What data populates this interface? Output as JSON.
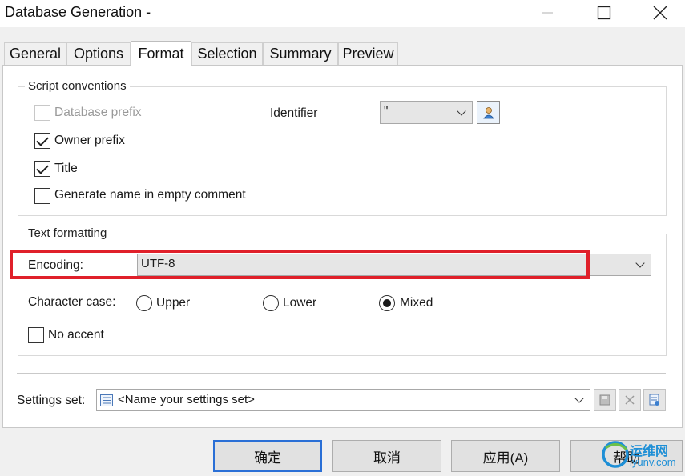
{
  "window": {
    "title": "Database Generation -",
    "minimize_icon": "minimize-icon",
    "maximize_icon": "maximize-icon",
    "close_icon": "close-icon"
  },
  "tabs": [
    {
      "label": "General",
      "active": false
    },
    {
      "label": "Options",
      "active": false
    },
    {
      "label": "Format",
      "active": true
    },
    {
      "label": "Selection",
      "active": false
    },
    {
      "label": "Summary",
      "active": false
    },
    {
      "label": "Preview",
      "active": false
    }
  ],
  "script_conventions": {
    "legend": "Script conventions",
    "database_prefix": {
      "label": "Database prefix",
      "checked": false,
      "enabled": false
    },
    "owner_prefix": {
      "label": "Owner prefix",
      "checked": true,
      "enabled": true
    },
    "title": {
      "label": "Title",
      "checked": true,
      "enabled": true
    },
    "generate_name": {
      "label": "Generate name in empty comment",
      "checked": false,
      "enabled": true
    },
    "identifier": {
      "label": "Identifier",
      "value": "\"",
      "icon": "user-properties-icon"
    }
  },
  "text_formatting": {
    "legend": "Text formatting",
    "encoding": {
      "label": "Encoding:",
      "value": "UTF-8"
    },
    "character_case": {
      "label": "Character case:",
      "options": [
        {
          "label": "Upper",
          "selected": false
        },
        {
          "label": "Lower",
          "selected": false
        },
        {
          "label": "Mixed",
          "selected": true
        }
      ]
    },
    "no_accent": {
      "label": "No accent",
      "checked": false
    }
  },
  "settings_set": {
    "label": "Settings set:",
    "value": "<Name your settings set>",
    "icon": "settings-list-icon",
    "save_icon": "save-icon",
    "delete_icon": "delete-icon",
    "manage_icon": "manage-settings-icon"
  },
  "buttons": {
    "ok": "确定",
    "cancel": "取消",
    "apply": "应用(A)",
    "help": "帮助"
  },
  "watermark": {
    "line1": "运维网",
    "line2": "iyunv.com"
  },
  "colors": {
    "highlight": "#e0202a",
    "default_button_border": "#2a6fd6",
    "watermark": "#1e8fd6"
  }
}
